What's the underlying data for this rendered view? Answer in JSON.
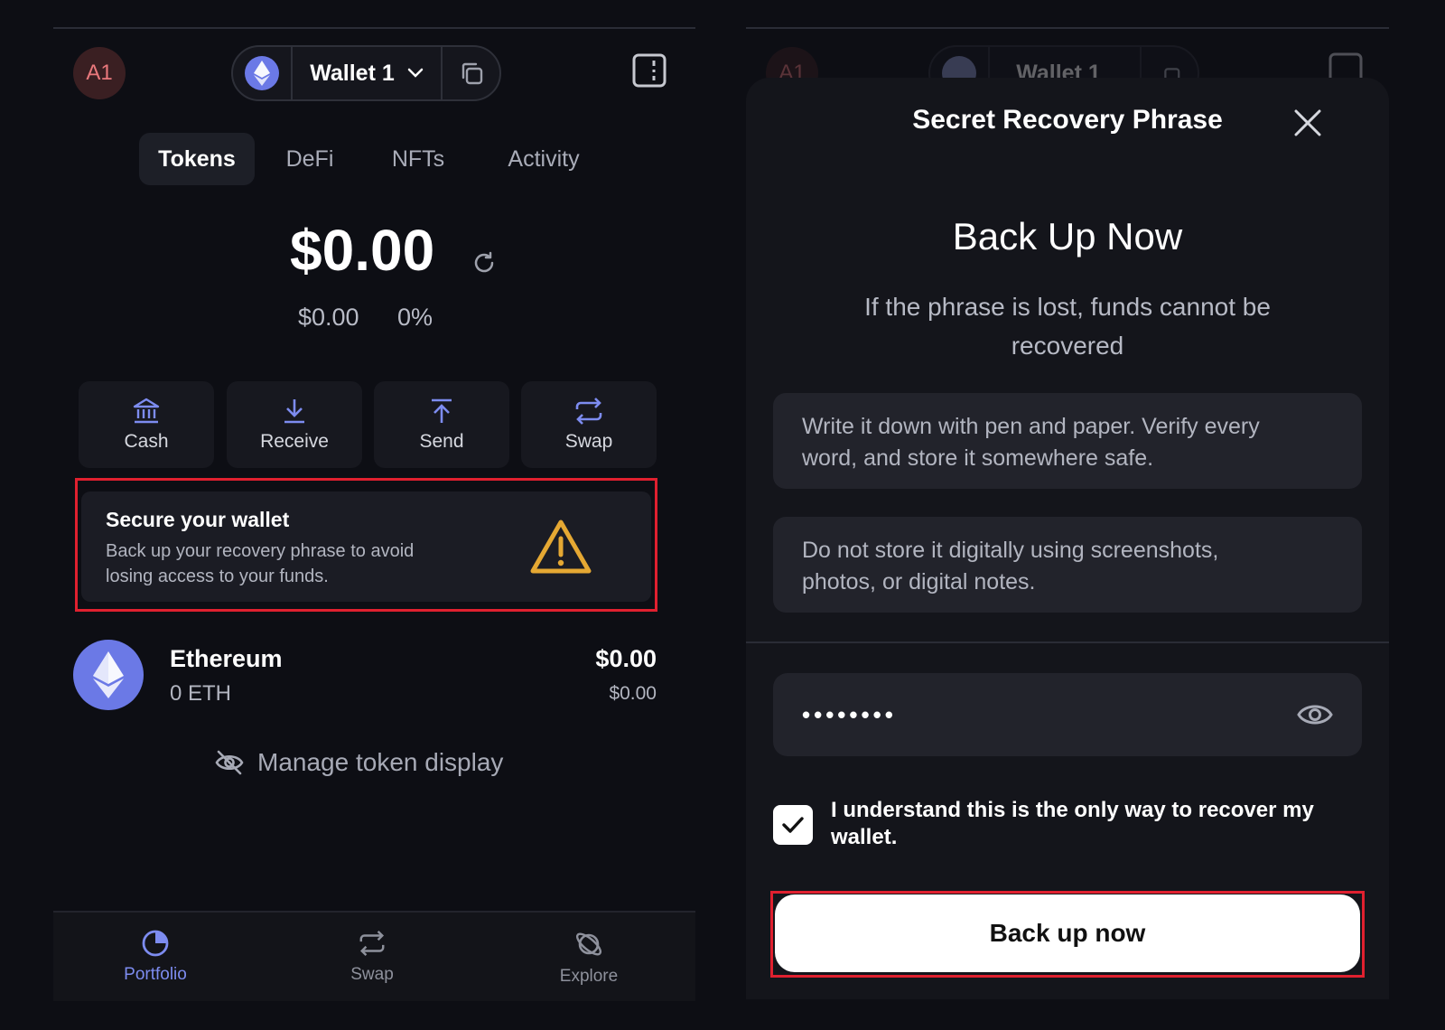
{
  "left": {
    "avatar_text": "A1",
    "wallet": {
      "name": "Wallet 1",
      "chain_icon": "ethereum-icon",
      "copy_icon": "copy-icon"
    },
    "tabs": [
      {
        "label": "Tokens",
        "active": true
      },
      {
        "label": "DeFi",
        "active": false
      },
      {
        "label": "NFTs",
        "active": false
      },
      {
        "label": "Activity",
        "active": false
      }
    ],
    "balance": {
      "total": "$0.00",
      "change_value": "$0.00",
      "change_pct": "0%"
    },
    "actions": [
      {
        "label": "Cash",
        "icon": "bank-icon"
      },
      {
        "label": "Receive",
        "icon": "download-icon"
      },
      {
        "label": "Send",
        "icon": "upload-icon"
      },
      {
        "label": "Swap",
        "icon": "swap-icon"
      }
    ],
    "secure_card": {
      "title": "Secure your wallet",
      "desc_line1": "Back up your recovery phrase to avoid",
      "desc_line2": "losing access to your funds."
    },
    "token": {
      "name": "Ethereum",
      "amount": "0 ETH",
      "value": "$0.00",
      "fiat": "$0.00"
    },
    "manage_label": "Manage token display",
    "bottom_nav": [
      {
        "label": "Portfolio",
        "active": true
      },
      {
        "label": "Swap",
        "active": false
      },
      {
        "label": "Explore",
        "active": false
      }
    ]
  },
  "right": {
    "bg_avatar_text": "A1",
    "bg_wallet_name": "Wallet 1",
    "sheet_title": "Secret Recovery Phrase",
    "heading": "Back Up Now",
    "lead_line1": "If the phrase is lost, funds cannot be",
    "lead_line2": "recovered",
    "tips": [
      {
        "line1": "Write it down with pen and paper. Verify every",
        "line2": "word, and store it somewhere safe."
      },
      {
        "line1": "Do not store it digitally using screenshots,",
        "line2": "photos, or digital notes."
      }
    ],
    "password_mask": "••••••••",
    "consent_line1": "I understand this is the only way to recover my",
    "consent_line2": "wallet.",
    "button_label": "Back up now"
  },
  "colors": {
    "background": "#0d0e14",
    "accent": "#7d8cf0",
    "highlight_border": "#e0202f",
    "warning": "#e5a833"
  }
}
